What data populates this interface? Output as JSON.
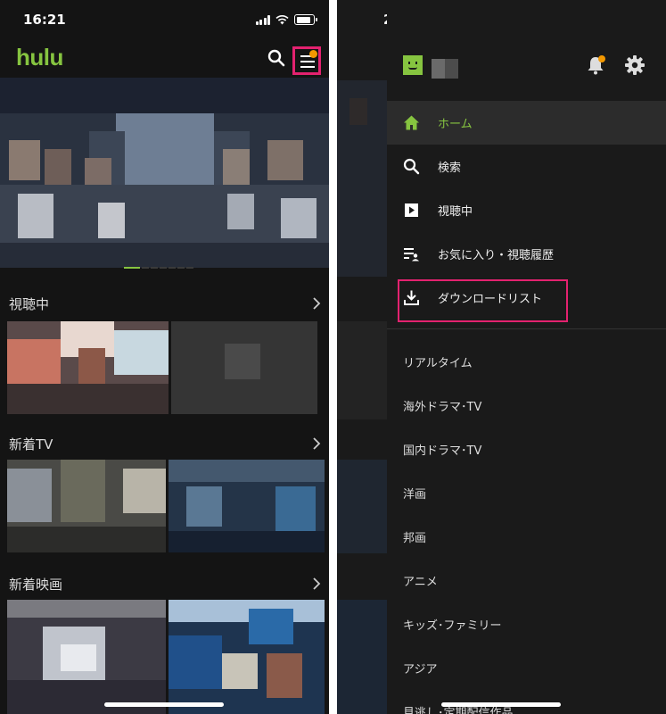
{
  "left_screen": {
    "status": {
      "time": "16:21"
    },
    "header": {
      "logo": "hulu"
    },
    "sections": [
      {
        "title": "視聴中"
      },
      {
        "title": "新着TV"
      },
      {
        "title": "新着映画"
      }
    ]
  },
  "right_screen": {
    "status": {
      "time_partial": "2"
    },
    "menu": [
      {
        "label": "ホーム",
        "icon": "home-icon",
        "active": true
      },
      {
        "label": "検索",
        "icon": "search-icon"
      },
      {
        "label": "視聴中",
        "icon": "play-icon"
      },
      {
        "label": "お気に入り・視聴履歴",
        "icon": "favorites-list-icon"
      },
      {
        "label": "ダウンロードリスト",
        "icon": "download-icon"
      }
    ],
    "categories": [
      "リアルタイム",
      "海外ドラマ･TV",
      "国内ドラマ･TV",
      "洋画",
      "邦画",
      "アニメ",
      "キッズ･ファミリー",
      "アジア",
      "見逃し･定期配信作品"
    ]
  },
  "colors": {
    "accent": "#86c440",
    "highlight": "#e3226f",
    "notification": "#f39800",
    "background": "#141414",
    "drawer": "#1a1a1a"
  }
}
